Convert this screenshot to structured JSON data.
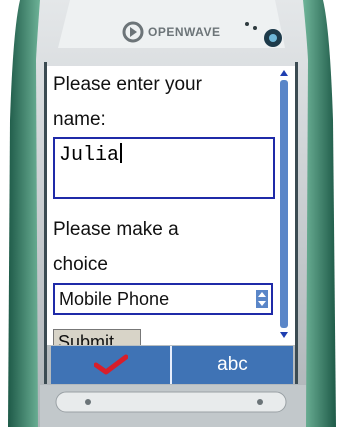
{
  "device": {
    "brand": "OPENWAVE",
    "colors": {
      "shell": "#5ea88c",
      "shell_dark": "#2e6e56",
      "bezel": "#cdd3d5",
      "softbar": "#3f73b5"
    }
  },
  "form": {
    "name_prompt": "Please enter your name:",
    "name_prompt_line1": "Please enter your",
    "name_prompt_line2": "name:",
    "name_value": "Julia",
    "choice_prompt_line1": "Please make a",
    "choice_prompt_line2": "choice",
    "choice_selected": "Mobile Phone",
    "submit_label": "Submit"
  },
  "softkeys": {
    "left_icon": "checkmark-icon",
    "right_label": "abc"
  }
}
